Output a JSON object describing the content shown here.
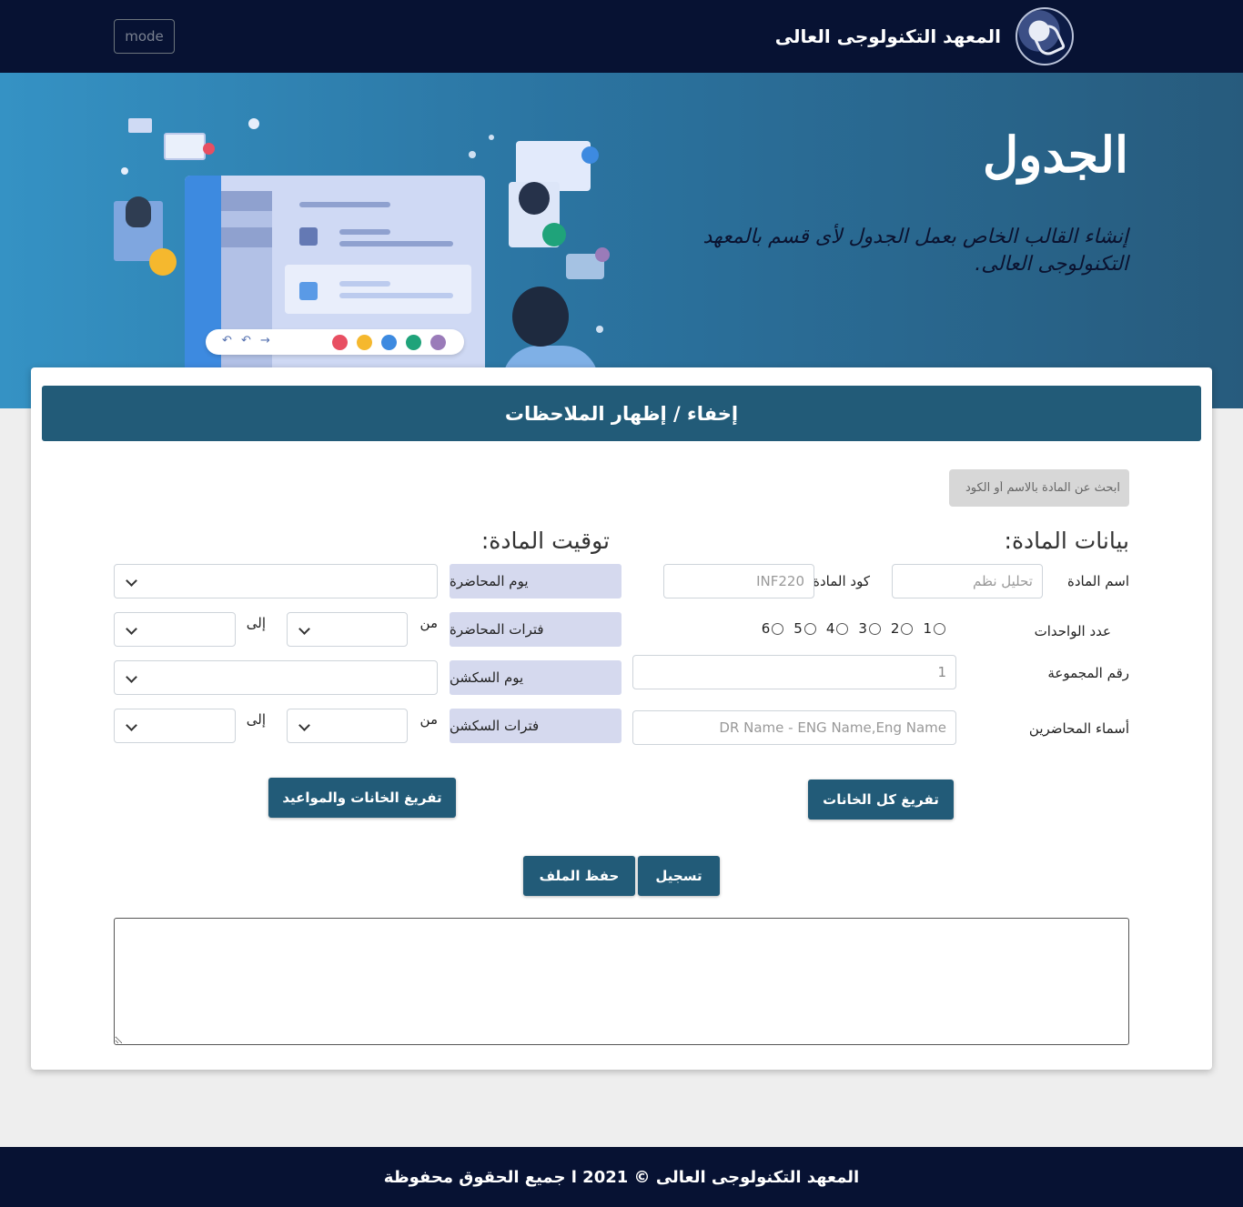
{
  "navbar": {
    "brand_title": "المعهد التكنولوجى العالى",
    "mode_label": "mode",
    "logo_icon": "institute-logo-icon"
  },
  "hero": {
    "title": "الجدول",
    "subtitle": "إنشاء القالب الخاص بعمل الجدول لأى قسم بالمعهد التكنولوجى العالى."
  },
  "notes_toggle": {
    "label": "إخفاء / إظهار الملاحظات"
  },
  "search": {
    "placeholder": "ابحث عن المادة بالاسم أو الكود"
  },
  "course_data": {
    "section_title": "بيانات المادة:",
    "name_label": "اسم المادة",
    "name_placeholder": "تحليل نظم",
    "code_label": "كود المادة",
    "code_placeholder": "INF220",
    "units_label": "عدد الواحدات",
    "units_options": [
      "1",
      "2",
      "3",
      "4",
      "5",
      "6"
    ],
    "group_label": "رقم المجموعة",
    "group_value": "1",
    "lecturers_label": "أسماء المحاضرين",
    "lecturers_placeholder": "DR Name - ENG Name,Eng Name"
  },
  "course_timing": {
    "section_title": "توقيت المادة:",
    "lecture_day_label": "يوم المحاضرة",
    "lecture_periods_label": "فترات المحاضرة",
    "section_day_label": "يوم السكشن",
    "section_periods_label": "فترات السكشن",
    "from_label": "من",
    "to_label": "إلى"
  },
  "actions": {
    "clear_all_label": "تفريغ كل الخانات",
    "clear_fields_schedules_label": "تفريغ الخانات والمواعيد",
    "register_label": "تسجيل",
    "save_file_label": "حفظ الملف"
  },
  "notes": {
    "value": ""
  },
  "footer": {
    "text": "المعهد التكنولوجى العالى © 2021 ا جميع الحقوق محفوظة"
  },
  "colors": {
    "navbar_bg": "#071233",
    "accent": "#225b78",
    "hero_start": "#3592c4",
    "hero_end": "#275b7d",
    "label_pill": "#d5d9ee"
  }
}
